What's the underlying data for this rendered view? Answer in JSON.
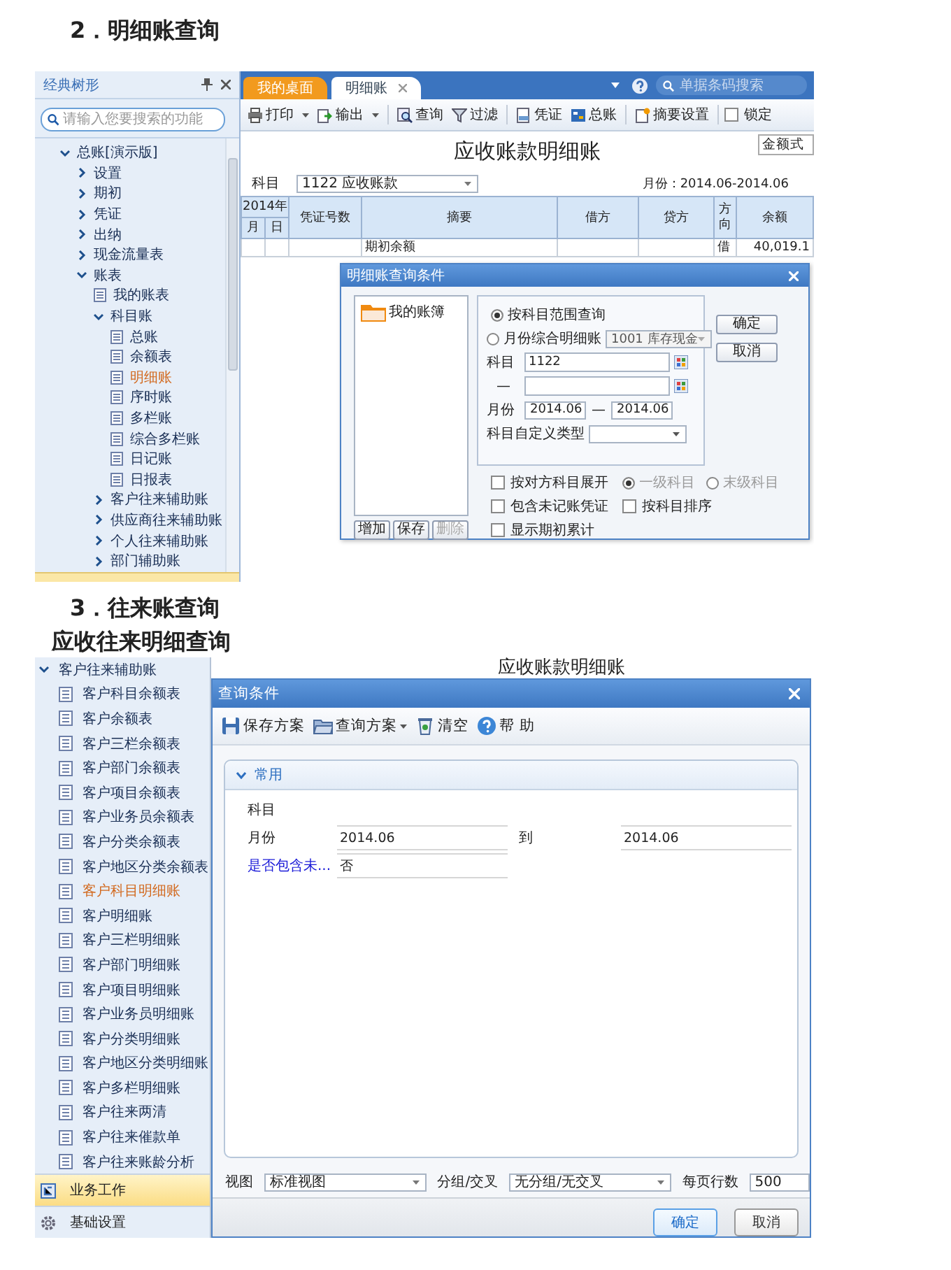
{
  "heading_1": "2．明细账查询",
  "screen_1": {
    "sidebar": {
      "title": "经典树形",
      "search": {
        "placeholder": "请输入您要搜索的功能"
      },
      "tree": [
        {
          "label": "总账[演示版]",
          "kind": "folder",
          "expanded": true,
          "selected": false,
          "children": [
            {
              "label": "设置",
              "kind": "folder",
              "expanded": false,
              "selected": false
            },
            {
              "label": "期初",
              "kind": "folder",
              "expanded": false,
              "selected": false
            },
            {
              "label": "凭证",
              "kind": "folder",
              "expanded": false,
              "selected": false
            },
            {
              "label": "出纳",
              "kind": "folder",
              "expanded": false,
              "selected": false
            },
            {
              "label": "现金流量表",
              "kind": "folder",
              "expanded": false,
              "selected": false
            },
            {
              "label": "账表",
              "kind": "folder",
              "expanded": true,
              "selected": false,
              "children": [
                {
                  "label": "我的账表",
                  "kind": "report",
                  "selected": false
                },
                {
                  "label": "科目账",
                  "kind": "folder",
                  "expanded": true,
                  "selected": false,
                  "children": [
                    {
                      "label": "总账",
                      "kind": "report",
                      "selected": false
                    },
                    {
                      "label": "余额表",
                      "kind": "report",
                      "selected": false
                    },
                    {
                      "label": "明细账",
                      "kind": "report",
                      "selected": true
                    },
                    {
                      "label": "序时账",
                      "kind": "report",
                      "selected": false
                    },
                    {
                      "label": "多栏账",
                      "kind": "report",
                      "selected": false
                    },
                    {
                      "label": "综合多栏账",
                      "kind": "report",
                      "selected": false
                    },
                    {
                      "label": "日记账",
                      "kind": "report",
                      "selected": false
                    },
                    {
                      "label": "日报表",
                      "kind": "report",
                      "selected": false
                    }
                  ]
                },
                {
                  "label": "客户往来辅助账",
                  "kind": "folder",
                  "expanded": false,
                  "selected": false
                },
                {
                  "label": "供应商往来辅助账",
                  "kind": "folder",
                  "expanded": false,
                  "selected": false
                },
                {
                  "label": "个人往来辅助账",
                  "kind": "folder",
                  "expanded": false,
                  "selected": false
                },
                {
                  "label": "部门辅助账",
                  "kind": "folder",
                  "expanded": false,
                  "selected": false
                }
              ]
            }
          ]
        }
      ]
    },
    "tabs": [
      {
        "label": "我的桌面",
        "selected": false,
        "closable": false
      },
      {
        "label": "明细账",
        "selected": true,
        "closable": true
      }
    ],
    "search": {
      "placeholder": "单据条码搜索"
    },
    "toolbar": [
      {
        "label": "打印",
        "dropdown": true
      },
      {
        "label": "输出",
        "dropdown": true
      },
      {
        "label": "查询",
        "dropdown": false
      },
      {
        "label": "过滤",
        "dropdown": false
      },
      {
        "label": "凭证",
        "dropdown": false
      },
      {
        "label": "总账",
        "dropdown": false
      },
      {
        "label": "摘要设置",
        "dropdown": false
      }
    ],
    "lock": {
      "label": "锁定",
      "checked": false
    },
    "report": {
      "title": "应收账款明细账",
      "format": "金额式",
      "subject_label": "科目",
      "subject": "1122 应收账款",
      "period": "月份：2014.06-2014.06",
      "year": "2014年",
      "columns": [
        "月",
        "日",
        "凭证号数",
        "摘要",
        "借方",
        "贷方",
        "方向",
        "余额"
      ],
      "rows": [
        {
          "cells": [
            "",
            "",
            "",
            "期初余额",
            "",
            "",
            "借",
            "40,019.1"
          ]
        }
      ]
    },
    "dialog": {
      "title": "明细账查询条件",
      "saved_list": [
        {
          "label": "我的账簿"
        }
      ],
      "list_buttons": [
        {
          "label": "增加",
          "disabled": false
        },
        {
          "label": "保存",
          "disabled": false
        },
        {
          "label": "删除",
          "disabled": true
        }
      ],
      "query_modes": [
        {
          "label": "按科目范围查询",
          "selected": true
        },
        {
          "label": "月份综合明细账",
          "selected": false
        }
      ],
      "summary_account": {
        "value": "1001 库存现金",
        "disabled": true
      },
      "subject_label": "科目",
      "subject_from": "1122",
      "subject_dash": "—",
      "month_label": "月份",
      "month_from": "2014.06",
      "month_dash": "—",
      "month_to": "2014.06",
      "custom_type_label": "科目自定义类型",
      "actions": [
        "确定",
        "取消"
      ],
      "options": [
        {
          "label": "按对方科目展开",
          "checked": false
        },
        {
          "label": "包含未记账凭证",
          "checked": false
        },
        {
          "label": "显示期初累计",
          "checked": false
        },
        {
          "label": "按科目排序",
          "checked": false
        }
      ],
      "levels": [
        {
          "label": "一级科目",
          "selected": true,
          "disabled": true
        },
        {
          "label": "末级科目",
          "selected": false,
          "disabled": true
        }
      ]
    }
  },
  "heading_2": "3．往来账查询",
  "heading_3": "应收往来明细查询",
  "screen_2": {
    "sidebar": {
      "tree": [
        {
          "label": "客户往来辅助账",
          "kind": "folder",
          "expanded": true,
          "selected": false,
          "children": [
            {
              "label": "客户科目余额表",
              "kind": "report",
              "selected": false
            },
            {
              "label": "客户余额表",
              "kind": "report",
              "selected": false
            },
            {
              "label": "客户三栏余额表",
              "kind": "report",
              "selected": false
            },
            {
              "label": "客户部门余额表",
              "kind": "report",
              "selected": false
            },
            {
              "label": "客户项目余额表",
              "kind": "report",
              "selected": false
            },
            {
              "label": "客户业务员余额表",
              "kind": "report",
              "selected": false
            },
            {
              "label": "客户分类余额表",
              "kind": "report",
              "selected": false
            },
            {
              "label": "客户地区分类余额表",
              "kind": "report",
              "selected": false
            },
            {
              "label": "客户科目明细账",
              "kind": "report",
              "selected": true
            },
            {
              "label": "客户明细账",
              "kind": "report",
              "selected": false
            },
            {
              "label": "客户三栏明细账",
              "kind": "report",
              "selected": false
            },
            {
              "label": "客户部门明细账",
              "kind": "report",
              "selected": false
            },
            {
              "label": "客户项目明细账",
              "kind": "report",
              "selected": false
            },
            {
              "label": "客户业务员明细账",
              "kind": "report",
              "selected": false
            },
            {
              "label": "客户分类明细账",
              "kind": "report",
              "selected": false
            },
            {
              "label": "客户地区分类明细账",
              "kind": "report",
              "selected": false
            },
            {
              "label": "客户多栏明细账",
              "kind": "report",
              "selected": false
            },
            {
              "label": "客户往来两清",
              "kind": "report",
              "selected": false
            },
            {
              "label": "客户往来催款单",
              "kind": "report",
              "selected": false
            },
            {
              "label": "客户往来账龄分析",
              "kind": "report",
              "selected": false
            }
          ]
        }
      ],
      "modules": [
        {
          "label": "业务工作",
          "selected": true
        },
        {
          "label": "基础设置",
          "selected": false
        }
      ]
    },
    "report_title": "应收账款明细账",
    "dialog": {
      "title": "查询条件",
      "toolbar": [
        {
          "label": "保存方案",
          "dropdown": false
        },
        {
          "label": "查询方案",
          "dropdown": true
        },
        {
          "label": "清空",
          "dropdown": false
        },
        {
          "label": "帮 助",
          "dropdown": false
        }
      ],
      "section": {
        "title": "常用",
        "expanded": true
      },
      "rows": [
        {
          "label": "科目",
          "link": false
        },
        {
          "label": "月份",
          "link": false,
          "value": "2014.06",
          "to_label": "到",
          "to_value": "2014.06"
        },
        {
          "label": "是否包含未...",
          "link": true,
          "value": "否"
        }
      ],
      "view_label": "视图",
      "view": "标准视图",
      "group_label": "分组/交叉",
      "group": "无分组/无交叉",
      "rows_label": "每页行数",
      "rows_per_page": "500",
      "actions": [
        {
          "label": "确定",
          "default": true
        },
        {
          "label": "取消",
          "default": false
        }
      ]
    }
  }
}
